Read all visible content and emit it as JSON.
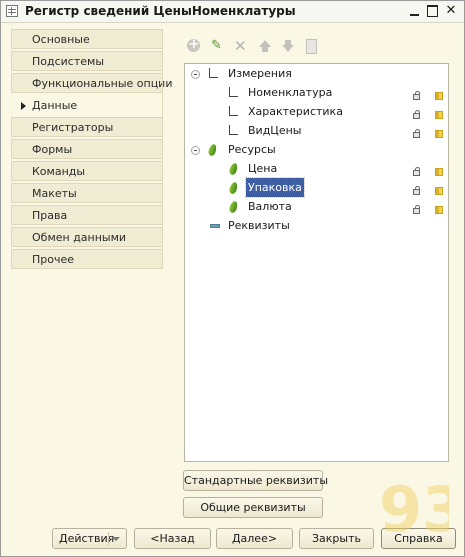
{
  "window": {
    "title": "Регистр сведений ЦеныНоменклатуры",
    "close_glyph": "✕"
  },
  "nav": {
    "items": [
      {
        "label": "Основные"
      },
      {
        "label": "Подсистемы"
      },
      {
        "label": "Функциональные опции"
      },
      {
        "label": "Данные",
        "active": true
      },
      {
        "label": "Регистраторы"
      },
      {
        "label": "Формы"
      },
      {
        "label": "Команды"
      },
      {
        "label": "Макеты"
      },
      {
        "label": "Права"
      },
      {
        "label": "Обмен данными"
      },
      {
        "label": "Прочее"
      }
    ]
  },
  "toolbar": {
    "edit_glyph": "✎",
    "delete_glyph": "✕"
  },
  "tree": {
    "dimensions": {
      "label": "Измерения",
      "items": [
        {
          "label": "Номенклатура"
        },
        {
          "label": "Характеристика"
        },
        {
          "label": "ВидЦены"
        }
      ]
    },
    "resources": {
      "label": "Ресурсы",
      "items": [
        {
          "label": "Цена"
        },
        {
          "label": "Упаковка",
          "selected": true
        },
        {
          "label": "Валюта"
        }
      ]
    },
    "requisites": {
      "label": "Реквизиты"
    }
  },
  "buttons": {
    "standard_attrs": "Стандартные реквизиты",
    "common_attrs": "Общие реквизиты",
    "actions": "Действия",
    "back": "<Назад",
    "next": "Далее>",
    "close": "Закрыть",
    "help": "Справка"
  },
  "watermark": {
    "text": "93"
  },
  "colors": {
    "selection": "#3f5fa5",
    "window_bg": "#fbf7e5",
    "tab_bg": "#f0ebd3"
  }
}
